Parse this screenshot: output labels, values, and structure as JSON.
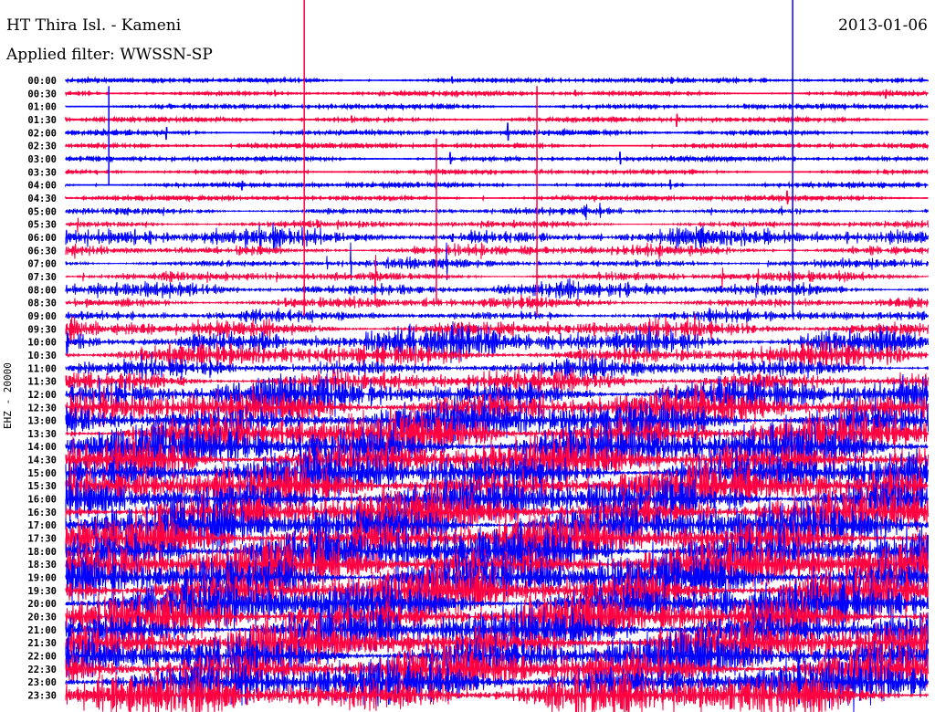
{
  "header": {
    "station": "HT Thira Isl. - Kameni",
    "filter": "Applied filter: WWSSN-SP",
    "date": "2013-01-06"
  },
  "chart_data": {
    "type": "line",
    "title": "HT Thira Isl. - Kameni",
    "subtitle": "Applied filter: WWSSN-SP",
    "ylabel": "EHZ - 20000",
    "minutes_per_line": 30,
    "row_labels": [
      "00:00",
      "00:30",
      "01:00",
      "01:30",
      "02:00",
      "02:30",
      "03:00",
      "03:30",
      "04:00",
      "04:30",
      "05:00",
      "05:30",
      "06:00",
      "06:30",
      "07:00",
      "07:30",
      "08:00",
      "08:30",
      "09:00",
      "09:30",
      "10:00",
      "10:30",
      "11:00",
      "11:30",
      "12:00",
      "12:30",
      "13:00",
      "13:30",
      "14:00",
      "14:30",
      "15:00",
      "15:30",
      "16:00",
      "16:30",
      "17:00",
      "17:30",
      "18:00",
      "18:30",
      "19:00",
      "19:30",
      "20:00",
      "20:30",
      "21:00",
      "21:30",
      "22:00",
      "22:30",
      "23:00",
      "23:30"
    ],
    "series_colors": [
      "#0000ff",
      "#ff0040"
    ],
    "relative_noise_amplitude": [
      1,
      1,
      1,
      1,
      1.2,
      1,
      1,
      0.8,
      1,
      1,
      2,
      2,
      5,
      3,
      2.5,
      2.5,
      4,
      3,
      3,
      5,
      8,
      6,
      5,
      6,
      9,
      10,
      11,
      11,
      12,
      12,
      12,
      12,
      12,
      12,
      13,
      13,
      13,
      13,
      13,
      13,
      13,
      12,
      12,
      12,
      12,
      12,
      12,
      12
    ],
    "events": [
      {
        "row": 0,
        "minute": 8.3,
        "span_rows": 18,
        "color": "#ff0040"
      },
      {
        "row": 0,
        "minute": 25.3,
        "span_rows": 18,
        "color": "#0000ff"
      },
      {
        "row": 1,
        "minute": 1.5,
        "span_rows": 7,
        "color": "#0000ff"
      },
      {
        "row": 1,
        "minute": 16.4,
        "span_rows": 17,
        "color": "#ff0040"
      },
      {
        "row": 5,
        "minute": 12.9,
        "span_rows": 12,
        "color": "#ff0040"
      }
    ]
  }
}
